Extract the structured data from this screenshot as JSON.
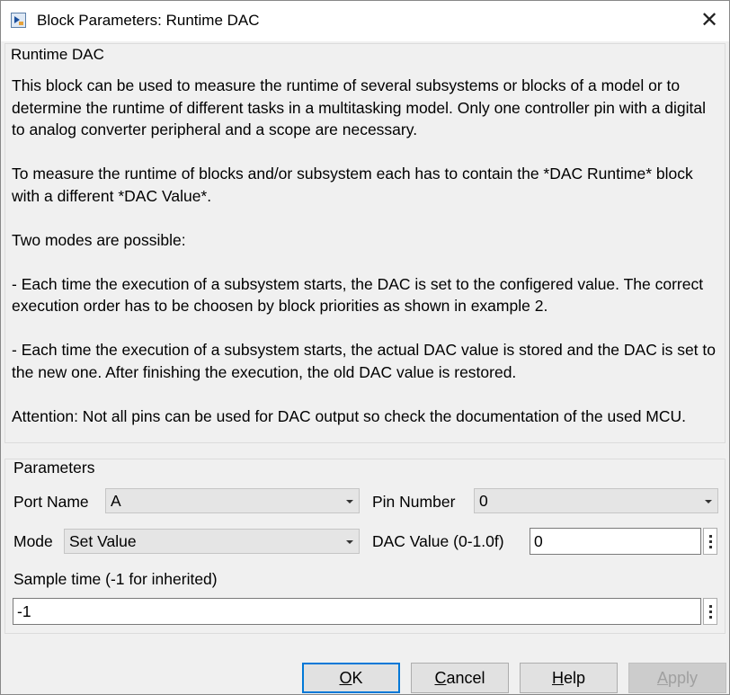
{
  "window": {
    "title": "Block Parameters: Runtime DAC"
  },
  "description": {
    "heading": "Runtime DAC",
    "body": "This block can be used to measure the runtime of several subsystems or blocks of a model or to determine the runtime of different tasks in a multitasking model. Only one controller pin with a digital to analog converter peripheral and a scope are necessary.\n\nTo measure the runtime of blocks and/or subsystem each has to contain the *DAC Runtime* block with a different *DAC Value*.\n\nTwo modes are possible:\n\n- Each time the execution of a subsystem starts, the DAC is set to the configered value. The correct execution order has to be choosen by block priorities as shown in example 2.\n\n- Each time the execution of a subsystem starts, the actual DAC value is stored and the DAC is set to the new one. After finishing the execution, the old DAC value is restored.\n\nAttention: Not all pins can be used for DAC output so check the documentation of the used MCU."
  },
  "parameters": {
    "heading": "Parameters",
    "port_name": {
      "label": "Port Name",
      "value": "A"
    },
    "pin_number": {
      "label": "Pin Number",
      "value": "0"
    },
    "mode": {
      "label": "Mode",
      "value": "Set Value"
    },
    "dac_value": {
      "label": "DAC Value (0-1.0f)",
      "value": "0"
    },
    "sample_time": {
      "label": "Sample time (-1 for inherited)",
      "value": "-1"
    }
  },
  "buttons": {
    "ok": {
      "prefix": "",
      "mnemonic": "O",
      "rest": "K"
    },
    "cancel": {
      "prefix": "",
      "mnemonic": "C",
      "rest": "ancel"
    },
    "help": {
      "prefix": "",
      "mnemonic": "H",
      "rest": "elp"
    },
    "apply": {
      "prefix": "",
      "mnemonic": "A",
      "rest": "pply"
    }
  },
  "colors": {
    "accent": "#0078d7",
    "window_bg": "#f0f0f0"
  },
  "icons": [
    "simulink-block-icon",
    "close-icon",
    "chevron-down-icon",
    "more-options-icon"
  ]
}
